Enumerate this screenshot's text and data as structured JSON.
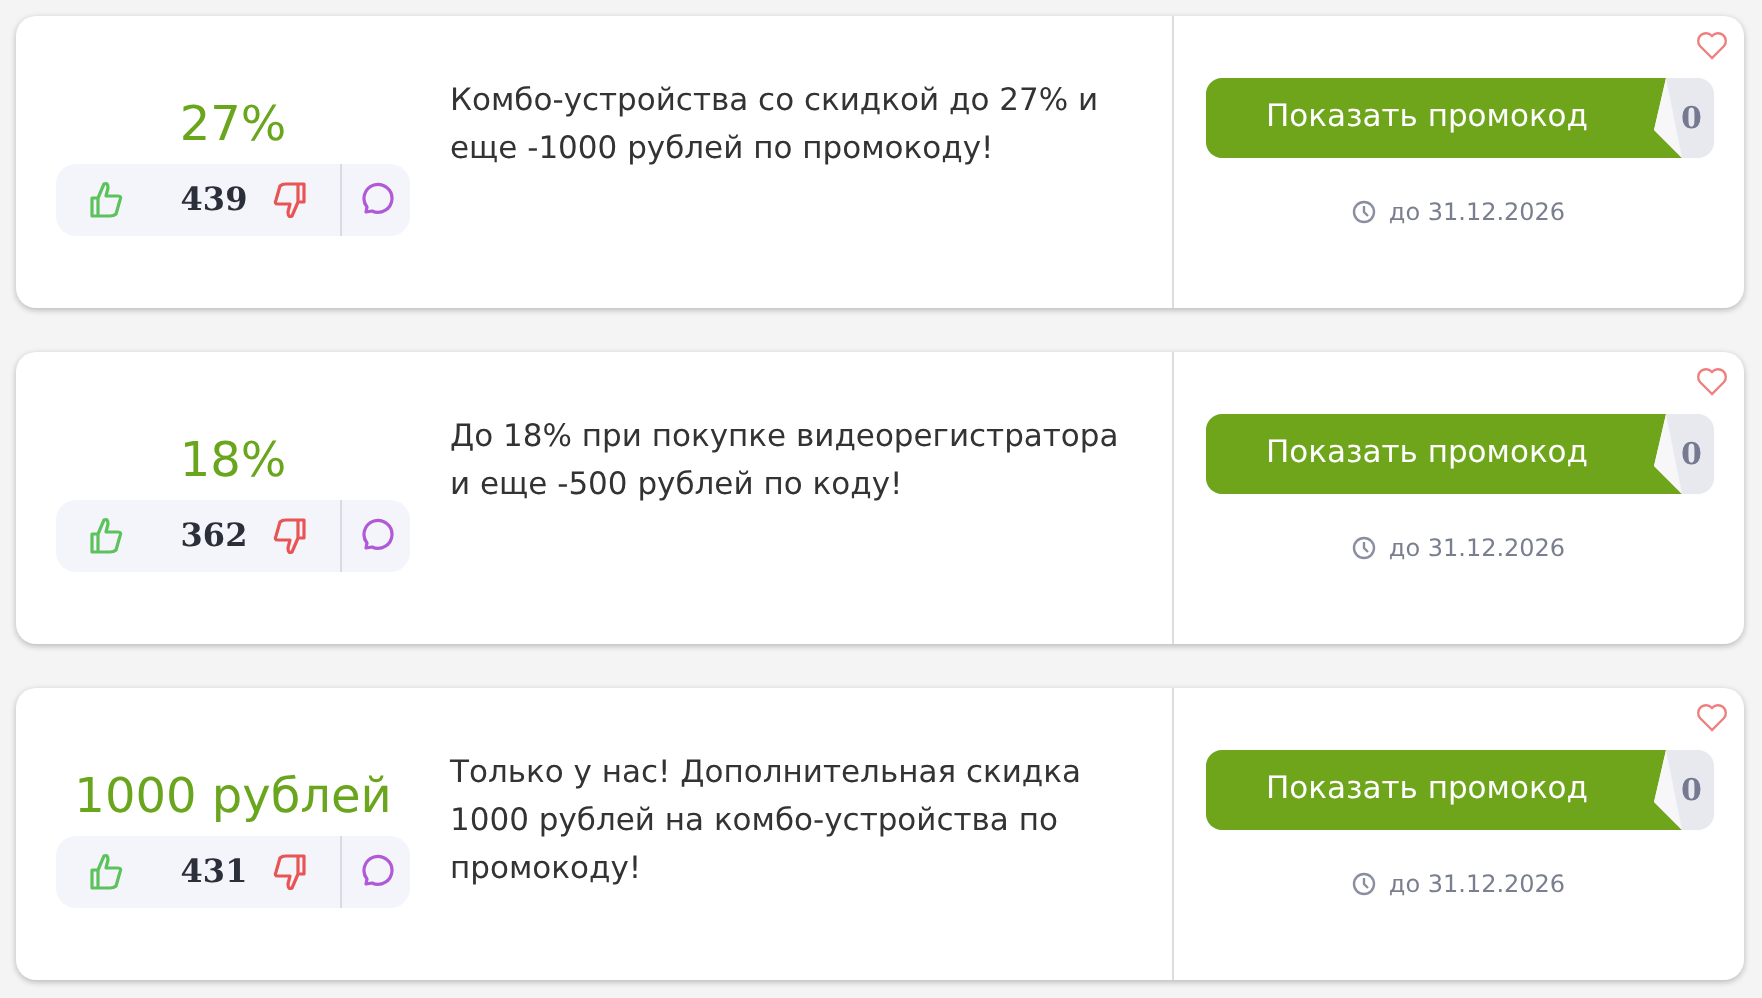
{
  "coupons": [
    {
      "discount": "27%",
      "votes": "439",
      "description": "Комбо-устройства со скидкой до 27% и еще -1000 рублей по промокоду!",
      "button": "Показать промокод",
      "code_hint": "0",
      "expiry": "до 31.12.2026",
      "favorite": false
    },
    {
      "discount": "18%",
      "votes": "362",
      "description": "До 18% при покупке видеорегистратора и еще -500 рублей по коду!",
      "button": "Показать промокод",
      "code_hint": "0",
      "expiry": "до 31.12.2026",
      "favorite": false
    },
    {
      "discount": "1000 рублей",
      "votes": "431",
      "description": "Только у нас! Дополнительная скидка 1000 рублей на комбо-устройства по промокоду!",
      "button": "Показать промокод",
      "code_hint": "0",
      "expiry": "до 31.12.2026",
      "favorite": false
    }
  ]
}
